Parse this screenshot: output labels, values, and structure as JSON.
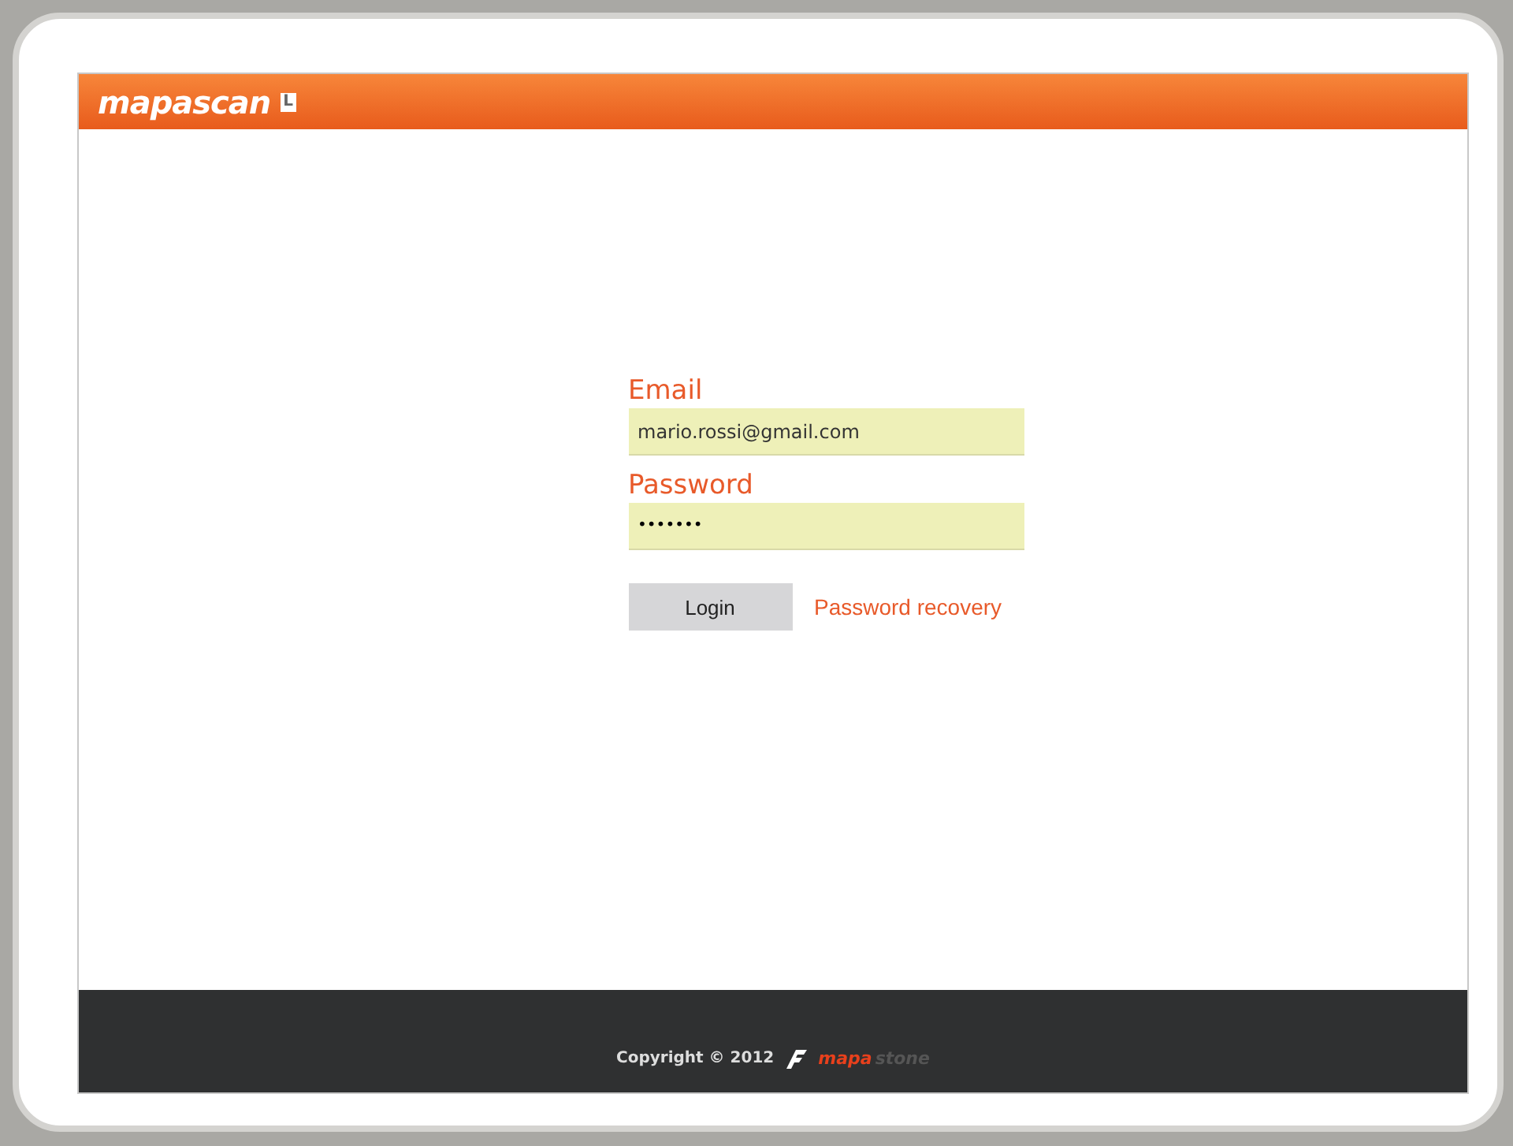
{
  "header": {
    "logo": "mapascan",
    "logo_badge": "L"
  },
  "form": {
    "email": {
      "label": "Email",
      "value": "mario.rossi@gmail.com"
    },
    "password": {
      "label": "Password",
      "value": "•••••••"
    },
    "login_button": "Login",
    "recovery_link": "Password recovery"
  },
  "footer": {
    "copyright": "Copyright © 2012",
    "brand_primary": "mapa",
    "brand_secondary": "stone"
  }
}
